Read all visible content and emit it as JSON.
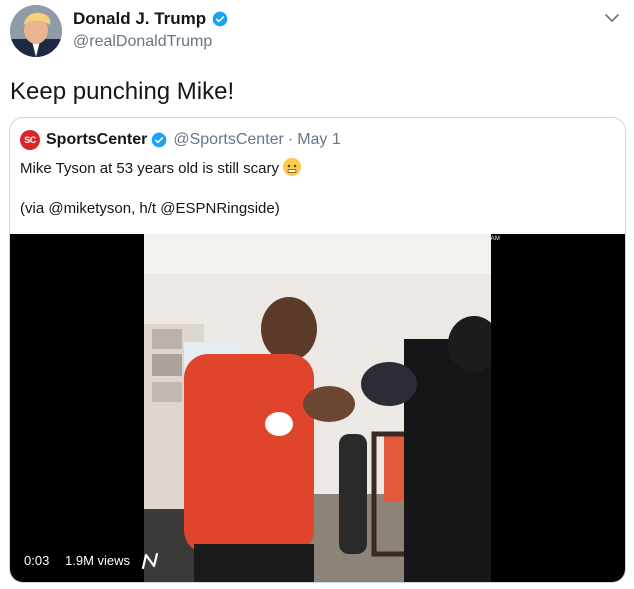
{
  "tweet": {
    "author_name": "Donald J. Trump",
    "handle": "@realDonaldTrump",
    "text": "Keep punching Mike!"
  },
  "quoted": {
    "logo_text": "SC",
    "author_name": "SportsCenter",
    "handle": "@SportsCenter",
    "separator": "·",
    "date": "May 1",
    "text_line1": "Mike Tyson at 53 years old is still scary",
    "text_line2": "(via @miketyson, h/t @ESPNRingside)"
  },
  "video": {
    "time": "0:03",
    "views": "1.9M views",
    "watermark": "MIKETYSON/INSTAGRAM"
  },
  "icons": {
    "verified": "verified-badge-icon",
    "caret": "chevron-down-icon",
    "emoji": "fearful-face-emoji-icon"
  },
  "colors": {
    "verified": "#1da1f2",
    "secondary_text": "#657786",
    "border": "#ccd6dd",
    "espn_red": "#d8262a"
  }
}
